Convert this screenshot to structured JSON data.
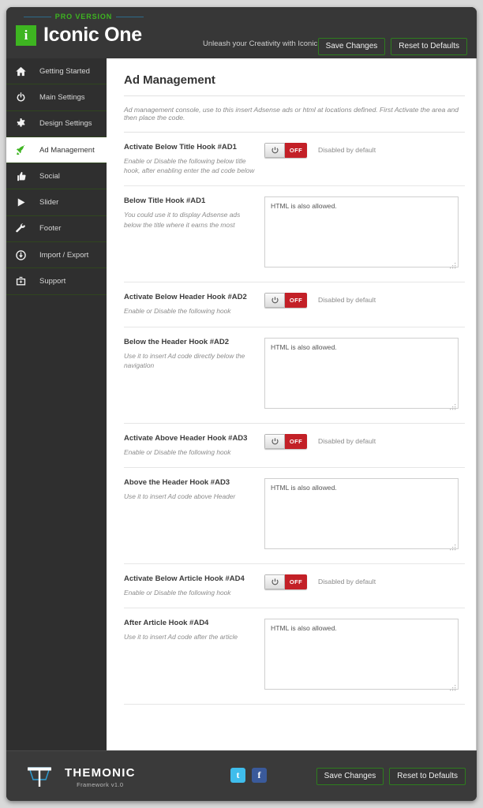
{
  "header": {
    "pro_label": "PRO  VERSION",
    "brand_mark": "i",
    "brand_name": "Iconic One",
    "tagline": "Unleash your Creativity with Iconic Themes",
    "save_label": "Save Changes",
    "reset_label": "Reset to Defaults"
  },
  "sidebar": {
    "items": [
      {
        "label": "Getting Started",
        "icon": "home-icon",
        "active": false
      },
      {
        "label": "Main Settings",
        "icon": "power-icon",
        "active": false
      },
      {
        "label": "Design Settings",
        "icon": "gear-icon",
        "active": false
      },
      {
        "label": "Ad Management",
        "icon": "rocket-icon",
        "active": true
      },
      {
        "label": "Social",
        "icon": "thumbs-up-icon",
        "active": false
      },
      {
        "label": "Slider",
        "icon": "play-icon",
        "active": false
      },
      {
        "label": "Footer",
        "icon": "wrench-icon",
        "active": false
      },
      {
        "label": "Import / Export",
        "icon": "download-icon",
        "active": false
      },
      {
        "label": "Support",
        "icon": "briefcase-icon",
        "active": false
      }
    ]
  },
  "main": {
    "title": "Ad Management",
    "description": "Ad management console, use to this insert Adsense ads or html at locations defined. First Activate the area and then place the code.",
    "rows": [
      {
        "kind": "toggle",
        "title": "Activate Below Title Hook #AD1",
        "sub": "Enable or Disable the following below title hook, after enabling enter the ad code below",
        "toggle_state": "OFF",
        "note": "Disabled by default"
      },
      {
        "kind": "textarea",
        "title": "Below Title Hook #AD1",
        "sub": "You could use it to display Adsense ads below the title where it earns the most",
        "value": "HTML is also allowed.",
        "placeholder": "HTML is also allowed."
      },
      {
        "kind": "toggle",
        "title": "Activate Below Header Hook #AD2",
        "sub": "Enable or Disable the following hook",
        "toggle_state": "OFF",
        "note": "Disabled by default"
      },
      {
        "kind": "textarea",
        "title": "Below the Header Hook #AD2",
        "sub": "Use it to insert Ad code directly below the navigation",
        "value": "HTML is also allowed.",
        "placeholder": "HTML is also allowed."
      },
      {
        "kind": "toggle",
        "title": "Activate Above Header Hook #AD3",
        "sub": "Enable or Disable the following hook",
        "toggle_state": "OFF",
        "note": "Disabled by default"
      },
      {
        "kind": "textarea",
        "title": "Above the Header Hook #AD3",
        "sub": "Use it to insert Ad code above Header",
        "value": "HTML is also allowed.",
        "placeholder": "HTML is also allowed."
      },
      {
        "kind": "toggle",
        "title": "Activate Below Article Hook #AD4",
        "sub": "Enable or Disable the following hook",
        "toggle_state": "OFF",
        "note": "Disabled by default"
      },
      {
        "kind": "textarea",
        "title": "After Article Hook #AD4",
        "sub": "Use it to insert Ad code after the article",
        "value": "HTML is also allowed.",
        "placeholder": "HTML is also allowed."
      }
    ]
  },
  "footer": {
    "brand_name": "THEMONIC",
    "version": "Framework v1.0",
    "socials": [
      {
        "name": "twitter-icon",
        "glyph": "t"
      },
      {
        "name": "facebook-icon",
        "glyph": "f"
      }
    ],
    "save_label": "Save Changes",
    "reset_label": "Reset to Defaults"
  },
  "colors": {
    "accent_green": "#3eb521",
    "panel_dark": "#373737",
    "sidebar_dark": "#2f2f2f",
    "toggle_off_red": "#c32027",
    "logo_blue": "#2f9fd6"
  }
}
